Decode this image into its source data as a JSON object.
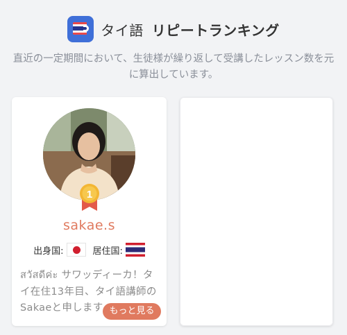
{
  "header": {
    "language": "タイ語",
    "title": "リピートランキング",
    "logo_icon": "thai-flag-app-icon",
    "accent_color": "#3f6fd8"
  },
  "subtitle": "直近の一定期間において、生徒様が繰り返して受講したレッスン数を元に算出しています。",
  "teachers": [
    {
      "rank": "1",
      "name": "sakae.s",
      "name_color": "#e07a5f",
      "origin_label": "出身国:",
      "origin_flag_icon": "japan-flag-icon",
      "residence_label": "居住国:",
      "residence_flag_icon": "thailand-flag-icon",
      "intro": "สวัสดีค่ะ サワッディーカ！タイ在住13年目、タイ語講師のSakaeと申します",
      "more_label": "もっと見る"
    }
  ]
}
